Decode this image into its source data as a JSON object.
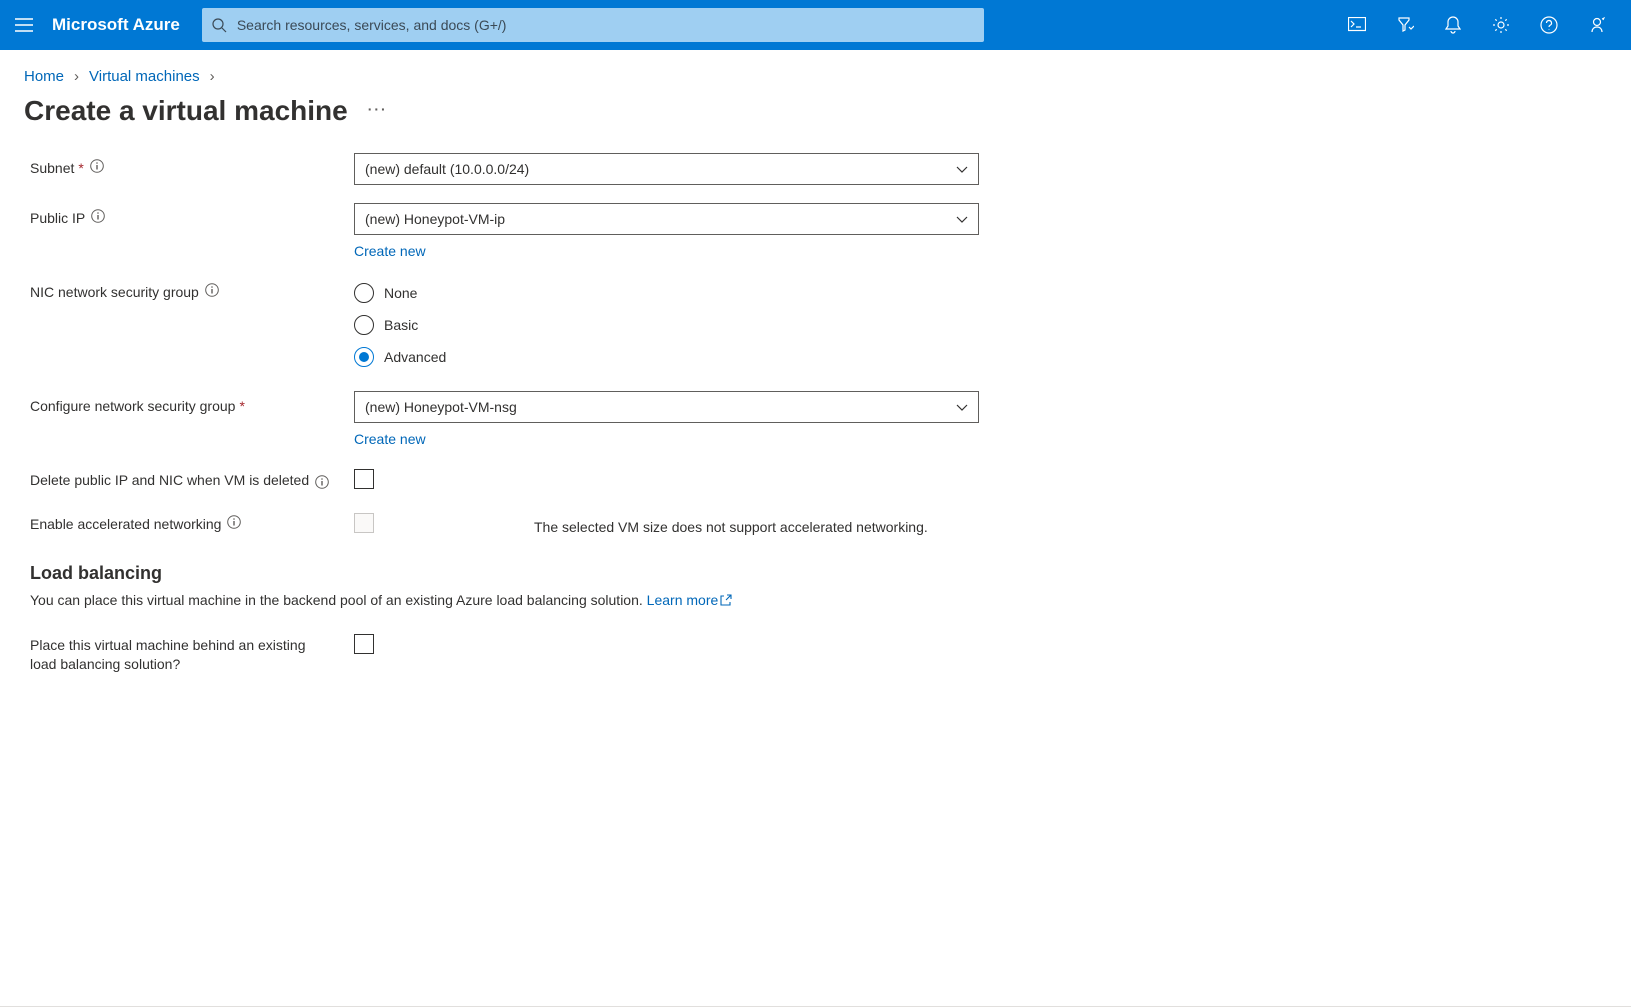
{
  "header": {
    "brand": "Microsoft Azure",
    "search_placeholder": "Search resources, services, and docs (G+/)"
  },
  "breadcrumbs": {
    "home": "Home",
    "vms": "Virtual machines"
  },
  "page": {
    "title": "Create a virtual machine"
  },
  "form": {
    "subnet": {
      "label": "Subnet",
      "value": "(new) default (10.0.0.0/24)"
    },
    "publicip": {
      "label": "Public IP",
      "value": "(new) Honeypot-VM-ip",
      "create_link": "Create new"
    },
    "nsg": {
      "label": "NIC network security group",
      "options": {
        "none": "None",
        "basic": "Basic",
        "advanced": "Advanced"
      },
      "selected": "advanced"
    },
    "confnsg": {
      "label": "Configure network security group",
      "value": "(new) Honeypot-VM-nsg",
      "create_link": "Create new"
    },
    "delip": {
      "label": "Delete public IP and NIC when VM is deleted"
    },
    "accel": {
      "label": "Enable accelerated networking",
      "msg": "The selected VM size does not support accelerated networking."
    },
    "loadbal": {
      "title": "Load balancing",
      "desc": "You can place this virtual machine in the backend pool of an existing Azure load balancing solution. ",
      "learn": "Learn more",
      "placelabel": "Place this virtual machine behind an existing load balancing solution?"
    }
  }
}
